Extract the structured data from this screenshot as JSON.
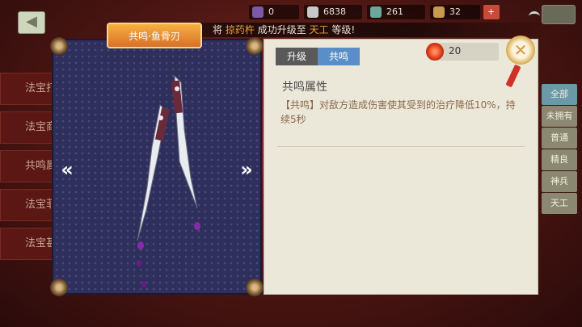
{
  "topbar": {
    "resources": [
      {
        "icon": "scroll-icon",
        "value": "0",
        "color": "#7a5aa8"
      },
      {
        "icon": "ingot-icon",
        "value": "6838",
        "color": "#c8c8c8"
      },
      {
        "icon": "jade-icon",
        "value": "261",
        "color": "#6aa89a"
      },
      {
        "icon": "tower-icon",
        "value": "32",
        "color": "#c89a50"
      }
    ]
  },
  "ticker": {
    "prefix": "将",
    "player": "掠药杵",
    "middle": "成功升级至",
    "level": "天工",
    "suffix": "等级!"
  },
  "left_tabs": [
    "法宝打",
    "法宝商",
    "共鸣属",
    "法宝菲",
    "法宝甚"
  ],
  "right_tabs": [
    {
      "label": "全部",
      "active": true
    },
    {
      "label": "未拥有",
      "active": false
    },
    {
      "label": "普通",
      "active": false
    },
    {
      "label": "精良",
      "active": false
    },
    {
      "label": "神兵",
      "active": false
    },
    {
      "label": "天工",
      "active": false
    }
  ],
  "modal": {
    "title": "共鸣·鱼骨刃",
    "tabs": [
      {
        "label": "升级",
        "active": false
      },
      {
        "label": "共鸣",
        "active": true
      }
    ],
    "currency": {
      "value": "20"
    },
    "section_title": "共鸣属性",
    "description": "【共鸣】对敌方造成伤害使其受到的治疗降低10%，持续5秒"
  },
  "colors": {
    "panel_bg": "#ebe7d9",
    "weapon_bg": "#2f2f5c",
    "tab_active": "#5a8ec8",
    "tab_inactive": "#595959",
    "banner": "#f0a040"
  }
}
